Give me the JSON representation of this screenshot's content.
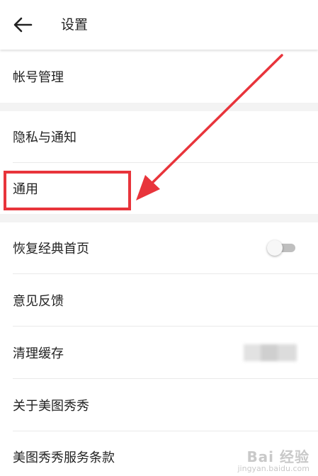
{
  "header": {
    "title": "设置"
  },
  "rows": {
    "account": {
      "label": "帐号管理"
    },
    "privacy": {
      "label": "隐私与通知"
    },
    "general": {
      "label": "通用"
    },
    "classic_home": {
      "label": "恢复经典首页",
      "toggle_on": false
    },
    "feedback": {
      "label": "意见反馈"
    },
    "clear_cache": {
      "label": "清理缓存"
    },
    "about": {
      "label": "关于美图秀秀"
    },
    "terms": {
      "label": "美图秀秀服务条款"
    }
  },
  "annotation": {
    "color": "#e8343b"
  },
  "watermark": {
    "brand": "Bai 经验",
    "url": "jingyan.baidu.com"
  },
  "colors": {
    "background": "#ffffff",
    "section_gap": "#f3f3f3",
    "divider": "#e9e9e9",
    "text": "#222222",
    "toggle_track": "#bfbfbf"
  }
}
